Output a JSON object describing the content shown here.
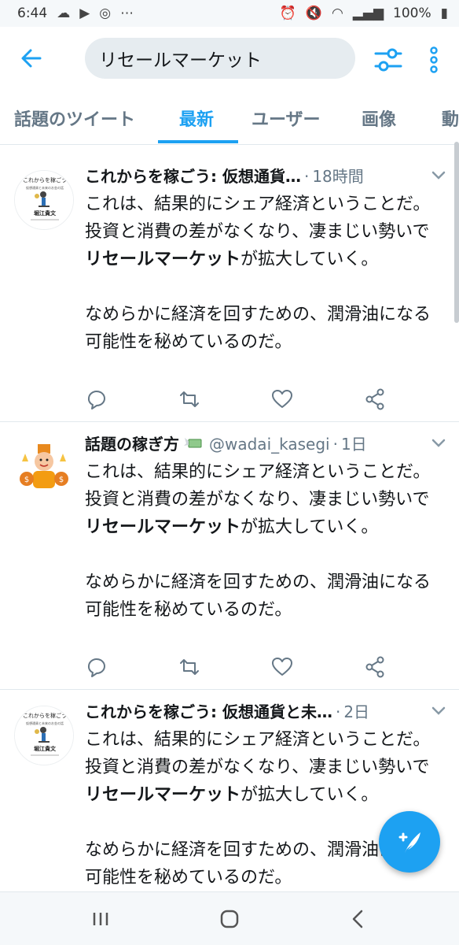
{
  "status_bar": {
    "time": "6:44",
    "battery": "100%"
  },
  "search": {
    "query": "リセールマーケット"
  },
  "tabs": [
    {
      "label": "話題のツイート"
    },
    {
      "label": "最新"
    },
    {
      "label": "ユーザー"
    },
    {
      "label": "画像"
    },
    {
      "label": "動"
    }
  ],
  "tweets": [
    {
      "name": "これからを稼ごう: 仮想通貨…",
      "handle": "",
      "time": "18時間",
      "body_pre": "これは、結果的にシェア経済ということだ。投資と消費の差がなくなり、凄まじい勢いで",
      "body_bold": "リセールマーケット",
      "body_post": "が拡大していく。",
      "body_2": "なめらかに経済を回すための、潤滑油になる可能性を秘めているのだ。"
    },
    {
      "name": "話題の稼ぎ方",
      "handle": "@wadai_kasegi",
      "time": "1日",
      "body_pre": "これは、結果的にシェア経済ということだ。投資と消費の差がなくなり、凄まじい勢いで",
      "body_bold": "リセールマーケット",
      "body_post": "が拡大していく。",
      "body_2": "なめらかに経済を回すための、潤滑油になる可能性を秘めているのだ。"
    },
    {
      "name": "これからを稼ごう: 仮想通貨と未…",
      "handle": "",
      "time": "2日",
      "body_pre": "これは、結果的にシェア経済ということだ。投資と消費の差がなくなり、凄まじい勢いで",
      "body_bold": "リセールマーケット",
      "body_post": "が拡大していく。",
      "body_2": "なめらかに経済を回すための、潤滑油になる可能性を秘めているのだ。"
    }
  ],
  "book_cover": {
    "title": "これからを稼ごう",
    "subtitle": "仮想通貨と未来のお金の話",
    "author": "堀江貴文"
  },
  "colors": {
    "accent": "#1da1f2",
    "text": "#14171a",
    "secondary": "#657786"
  }
}
